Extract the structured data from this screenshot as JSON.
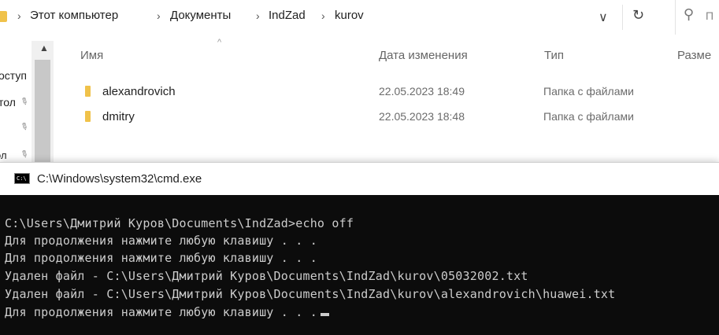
{
  "explorer": {
    "breadcrumb": [
      "Этот компьютер",
      "Документы",
      "IndZad",
      "kurov"
    ],
    "breadcrumb_separator": "›",
    "dropdown_glyph": "∨",
    "refresh_glyph": "↻",
    "search_placeholder": "П",
    "nav_items": [
      "оступ",
      "тол",
      "ол"
    ],
    "columns": {
      "name": "Имя",
      "date": "Дата изменения",
      "type": "Тип",
      "size": "Разме"
    },
    "files": [
      {
        "name": "alexandrovich",
        "date": "22.05.2023 18:49",
        "type": "Папка с файлами"
      },
      {
        "name": "dmitry",
        "date": "22.05.2023 18:48",
        "type": "Папка с файлами"
      }
    ],
    "folder_color": "#f0c24a"
  },
  "cmd": {
    "title": "C:\\Windows\\system32\\cmd.exe",
    "icon_text": "C:\\",
    "lines": [
      "C:\\Users\\Дмитрий Куров\\Documents\\IndZad>echo off",
      "Для продолжения нажмите любую клавишу . . .",
      "Для продолжения нажмите любую клавишу . . .",
      "Удален файл - C:\\Users\\Дмитрий Куров\\Documents\\IndZad\\kurov\\05032002.txt",
      "Удален файл - C:\\Users\\Дмитрий Куров\\Documents\\IndZad\\kurov\\alexandrovich\\huawei.txt",
      "Для продолжения нажмите любую клавишу . . ."
    ],
    "background": "#0c0c0c",
    "foreground": "#cccccc"
  }
}
